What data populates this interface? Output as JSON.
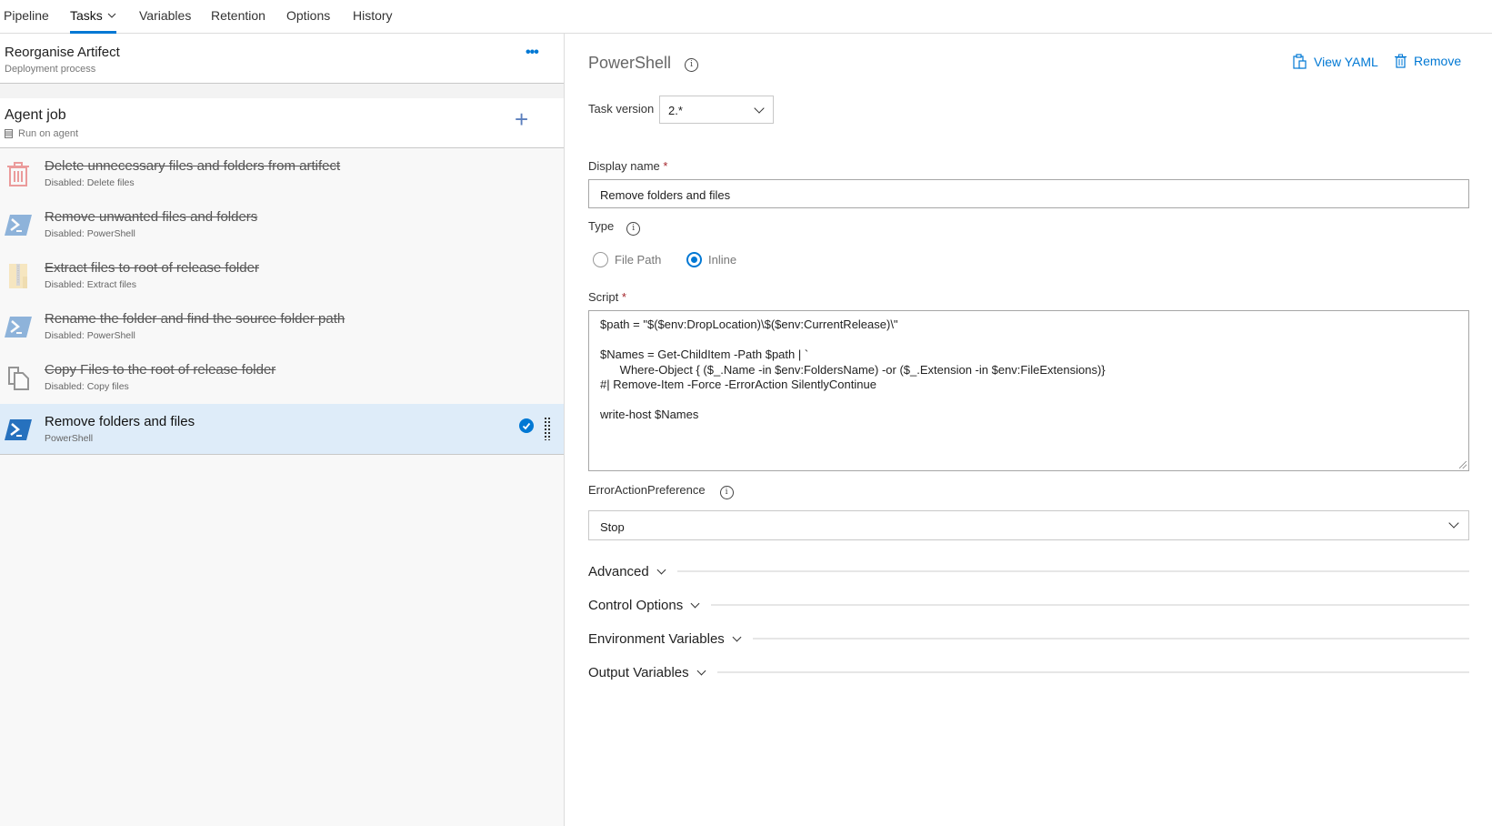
{
  "nav": {
    "tabs": [
      {
        "label": "Pipeline"
      },
      {
        "label": "Tasks",
        "active": true,
        "has_dropdown": true
      },
      {
        "label": "Variables"
      },
      {
        "label": "Retention"
      },
      {
        "label": "Options"
      },
      {
        "label": "History"
      }
    ]
  },
  "process": {
    "title": "Reorganise Artifect",
    "subtitle": "Deployment process",
    "more_icon": "ellipsis-icon"
  },
  "job": {
    "title": "Agent job",
    "subtitle": "Run on agent",
    "add_icon": "plus-icon"
  },
  "tasks": [
    {
      "title": "Delete unnecessary files and folders from artifect",
      "subtitle": "Disabled: Delete files",
      "icon": "trash-icon",
      "disabled": true
    },
    {
      "title": "Remove unwanted files and folders",
      "subtitle": "Disabled: PowerShell",
      "icon": "powershell-icon",
      "disabled": true
    },
    {
      "title": "Extract files to root of release folder",
      "subtitle": "Disabled: Extract files",
      "icon": "zip-icon",
      "disabled": true
    },
    {
      "title": "Rename the folder and find the source folder path",
      "subtitle": "Disabled: PowerShell",
      "icon": "powershell-icon",
      "disabled": true
    },
    {
      "title": "Copy Files to the root of release folder",
      "subtitle": "Disabled: Copy files",
      "icon": "copy-icon",
      "disabled": true
    },
    {
      "title": "Remove folders and files",
      "subtitle": "PowerShell",
      "icon": "powershell-icon",
      "disabled": false,
      "selected": true
    }
  ],
  "detail": {
    "title": "PowerShell",
    "view_yaml": "View YAML",
    "remove": "Remove",
    "task_version_label": "Task version",
    "task_version": "2.*",
    "display_name_label": "Display name",
    "display_name": "Remove folders and files",
    "required_mark": "*",
    "type_label": "Type",
    "type_options": [
      {
        "label": "File Path",
        "selected": false
      },
      {
        "label": "Inline",
        "selected": true
      }
    ],
    "script_label": "Script",
    "script": "$path = \"$($env:DropLocation)\\$($env:CurrentRelease)\\\"\n\n$Names = Get-ChildItem -Path $path | `\n      Where-Object { ($_.Name -in $env:FoldersName) -or ($_.Extension -in $env:FileExtensions)}\n#| Remove-Item -Force -ErrorAction SilentlyContinue\n\nwrite-host $Names",
    "error_pref_label": "ErrorActionPreference",
    "error_pref": "Stop",
    "sections": [
      {
        "label": "Advanced"
      },
      {
        "label": "Control Options"
      },
      {
        "label": "Environment Variables"
      },
      {
        "label": "Output Variables"
      }
    ]
  },
  "colors": {
    "accent": "#0078d4",
    "selected_row": "#deecf9",
    "required": "#a4262c"
  }
}
